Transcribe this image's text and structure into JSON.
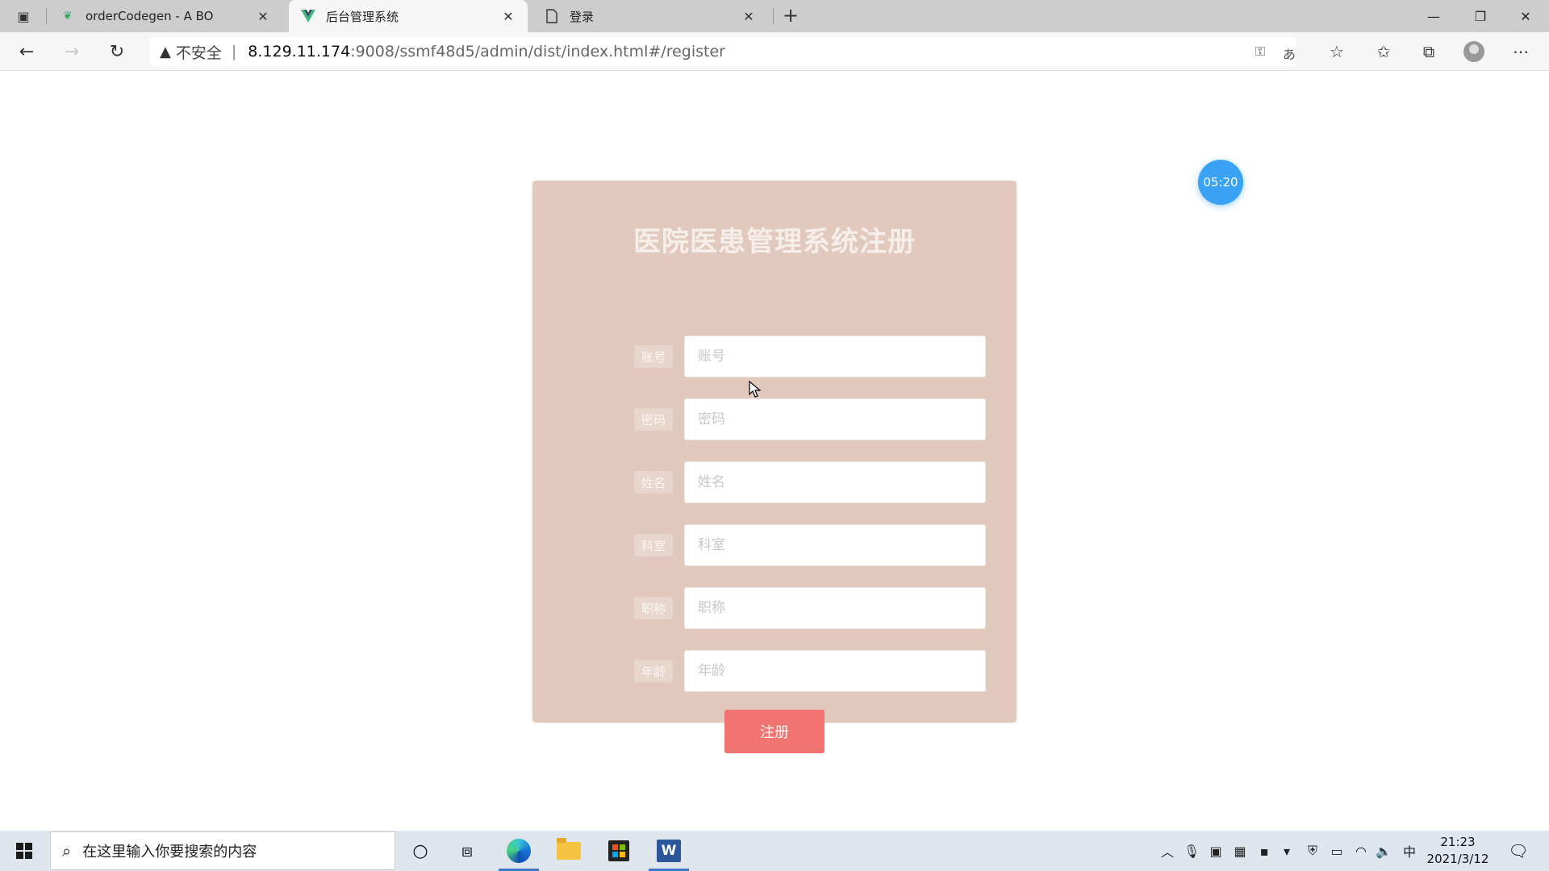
{
  "browser": {
    "tabs": [
      {
        "title": "orderCodegen - A BO",
        "favicon": "green-leaf-icon",
        "active": false
      },
      {
        "title": "后台管理系统",
        "favicon": "vue-logo-icon",
        "active": true
      },
      {
        "title": "登录",
        "favicon": "page-icon",
        "active": false
      }
    ],
    "address": {
      "security_label": "不安全",
      "url_host": "8.129.11.174",
      "url_rest": ":9008/ssmf48d5/admin/dist/index.html#/register"
    }
  },
  "page": {
    "timer_text": "05:20",
    "form_title": "医院医患管理系统注册",
    "fields": [
      {
        "label": "账号",
        "placeholder": "账号",
        "value": ""
      },
      {
        "label": "密码",
        "placeholder": "密码",
        "value": ""
      },
      {
        "label": "姓名",
        "placeholder": "姓名",
        "value": ""
      },
      {
        "label": "科室",
        "placeholder": "科室",
        "value": ""
      },
      {
        "label": "职称",
        "placeholder": "职称",
        "value": ""
      },
      {
        "label": "年龄",
        "placeholder": "年龄",
        "value": ""
      }
    ],
    "submit_label": "注册"
  },
  "taskbar": {
    "search_placeholder": "在这里输入你要搜索的内容",
    "ime_indicator": "中",
    "time": "21:23",
    "date": "2021/3/12"
  },
  "colors": {
    "card_bg": "#e2c9bd",
    "submit_bg": "#f17471",
    "timer_bg": "#3aa3f5"
  }
}
